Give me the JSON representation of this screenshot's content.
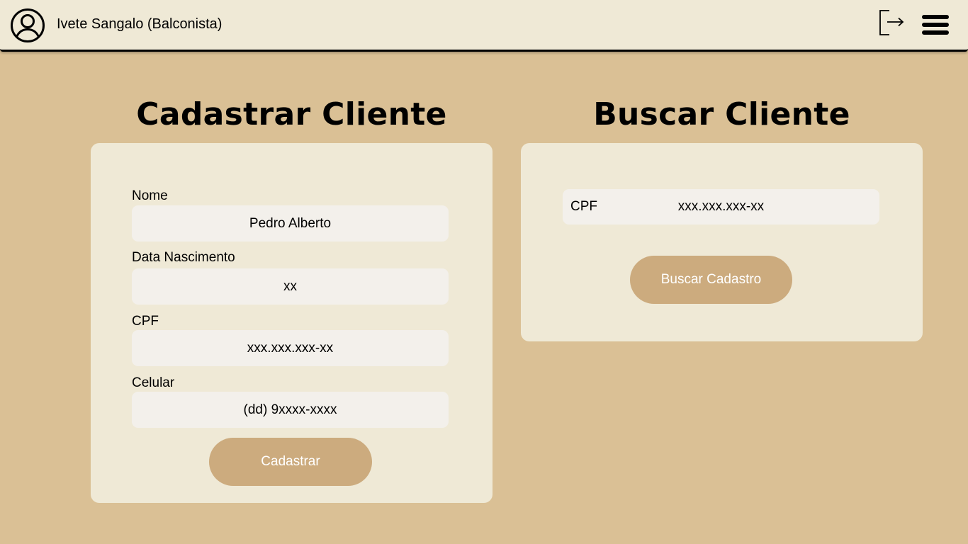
{
  "header": {
    "user_name": "Ivete Sangalo (Balconista)",
    "avatar_icon": "user-circle-icon",
    "logout_icon": "logout-icon",
    "menu_icon": "hamburger-menu-icon"
  },
  "register": {
    "title": "Cadastrar Cliente",
    "fields": [
      {
        "label": "Nome",
        "value": "Pedro Alberto"
      },
      {
        "label": "Data Nascimento",
        "value": "xx"
      },
      {
        "label": "CPF",
        "value": "xxx.xxx.xxx-xx"
      },
      {
        "label": "Celular",
        "value": "(dd) 9xxxx-xxxx"
      }
    ],
    "submit_label": "Cadastrar"
  },
  "search": {
    "title": "Buscar Cliente",
    "field_label": "CPF",
    "field_value": "xxx.xxx.xxx-xx",
    "submit_label": "Buscar Cadastro"
  },
  "colors": {
    "background": "#dac095",
    "card": "#efe9d6",
    "input": "#f3f0eb",
    "button": "#ccab7e"
  }
}
